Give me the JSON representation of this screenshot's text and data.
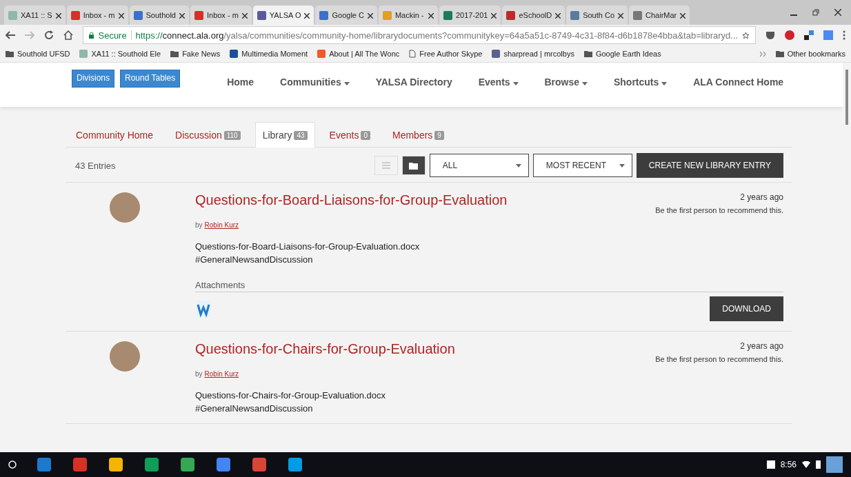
{
  "browser_tabs": [
    {
      "title": "XA11 :: S",
      "color": "#8fb8a8",
      "selected": false
    },
    {
      "title": "Inbox - m",
      "color": "#d93025",
      "selected": false
    },
    {
      "title": "Southold",
      "color": "#3b6fd0",
      "selected": false
    },
    {
      "title": "Inbox - m",
      "color": "#d93025",
      "selected": false
    },
    {
      "title": "YALSA O",
      "color": "#5a5a9a",
      "selected": true
    },
    {
      "title": "Google C",
      "color": "#3b6fd0",
      "selected": false
    },
    {
      "title": "Mackin -",
      "color": "#e0a020",
      "selected": false
    },
    {
      "title": "2017-201",
      "color": "#1e7a5a",
      "selected": false
    },
    {
      "title": "eSchoolD",
      "color": "#c0282a",
      "selected": false
    },
    {
      "title": "South Co",
      "color": "#5a7aa0",
      "selected": false
    },
    {
      "title": "ChairMar",
      "color": "#777777",
      "selected": false
    }
  ],
  "address_bar": {
    "secure_label": "Secure",
    "scheme": "https://",
    "host": "connect.ala.org",
    "path": "/yalsa/communities/community-home/librarydocuments?communitykey=64a5a51c-8749-4c31-8f84-d6b1878e4bba&tab=libraryd..."
  },
  "bookmarks": [
    {
      "kind": "folder",
      "label": "Southold UFSD"
    },
    {
      "kind": "site",
      "label": "XA11 :: Southold Ele",
      "color": "#8fb8a8"
    },
    {
      "kind": "folder",
      "label": "Fake News"
    },
    {
      "kind": "site",
      "label": "Multimedia Moment",
      "color": "#1a4f9a"
    },
    {
      "kind": "site",
      "label": "About | All The Wonc",
      "color": "#f05a28"
    },
    {
      "kind": "page",
      "label": "Free Author Skype"
    },
    {
      "kind": "site",
      "label": "sharpread | mrcolbys",
      "color": "#5a6090"
    },
    {
      "kind": "folder",
      "label": "Google Earth Ideas"
    }
  ],
  "other_bookmarks": "Other bookmarks",
  "site_buttons": [
    "Divisions",
    "Round Tables"
  ],
  "site_nav": [
    {
      "label": "Home",
      "dropdown": false
    },
    {
      "label": "Communities",
      "dropdown": true
    },
    {
      "label": "YALSA Directory",
      "dropdown": false
    },
    {
      "label": "Events",
      "dropdown": true
    },
    {
      "label": "Browse",
      "dropdown": true
    },
    {
      "label": "Shortcuts",
      "dropdown": true
    },
    {
      "label": "ALA Connect Home",
      "dropdown": false
    }
  ],
  "community_tabs": [
    {
      "label": "Community Home",
      "selected": false
    },
    {
      "label": "Discussion",
      "count": "110",
      "selected": false
    },
    {
      "label": "Library",
      "count": "43",
      "selected": true
    },
    {
      "label": "Events",
      "count": "0",
      "selected": false
    },
    {
      "label": "Members",
      "count": "9",
      "selected": false
    }
  ],
  "toolbar": {
    "entries": "43 Entries",
    "view_buttons": [
      {
        "kind": "list",
        "selected": false
      },
      {
        "kind": "folder",
        "selected": true
      }
    ],
    "filter": "ALL",
    "sort": "MOST RECENT",
    "create_button": "CREATE NEW LIBRARY ENTRY"
  },
  "entries": [
    {
      "title": "Questions-for-Board-Liaisons-for-Group-Evaluation",
      "by": "by",
      "author": "Robin Kurz",
      "age": "2 years ago",
      "recommend": "Be the first person to recommend this.",
      "file": "Questions-for-Board-Liaisons-for-Group-Evaluation.docx",
      "tag": "#GeneralNewsandDiscussion",
      "attachments": "Attachments",
      "download": "DOWNLOAD"
    },
    {
      "title": "Questions-for-Chairs-for-Group-Evaluation",
      "by": "by",
      "author": "Robin Kurz",
      "age": "2 years ago",
      "recommend": "Be the first person to recommend this.",
      "file": "Questions-for-Chairs-for-Group-Evaluation.docx",
      "tag": "#GeneralNewsandDiscussion"
    }
  ],
  "taskbar": {
    "apps": [
      {
        "color": "#1a7ad0"
      },
      {
        "color": "#d93025"
      },
      {
        "color": "#f4b400"
      },
      {
        "color": "#0f9d58"
      },
      {
        "color": "#34a853"
      },
      {
        "color": "#4285f4"
      },
      {
        "color": "#db4437"
      },
      {
        "color": "#039be5"
      }
    ],
    "time": "8:56"
  }
}
